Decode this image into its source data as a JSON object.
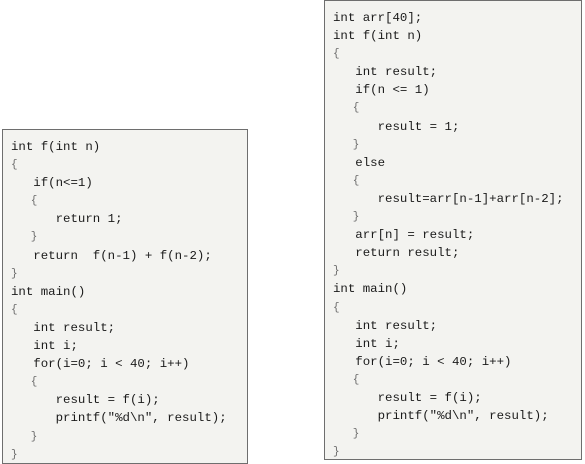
{
  "left_code": [
    "int f(int n)",
    "{",
    "   if(n<=1)",
    "   {",
    "      return 1;",
    "   }",
    "   return  f(n-1) + f(n-2);",
    "}",
    "int main()",
    "{",
    "   int result;",
    "   int i;",
    "   for(i=0; i < 40; i++)",
    "   {",
    "      result = f(i);",
    "      printf(\"%d\\n\", result);",
    "   }",
    "}"
  ],
  "right_code": [
    "int arr[40];",
    "int f(int n)",
    "{",
    "   int result;",
    "   if(n <= 1)",
    "   {",
    "      result = 1;",
    "   }",
    "   else",
    "   {",
    "      result=arr[n-1]+arr[n-2];",
    "   }",
    "   arr[n] = result;",
    "   return result;",
    "}",
    "int main()",
    "{",
    "   int result;",
    "   int i;",
    "   for(i=0; i < 40; i++)",
    "   {",
    "      result = f(i);",
    "      printf(\"%d\\n\", result);",
    "   }",
    "}"
  ]
}
